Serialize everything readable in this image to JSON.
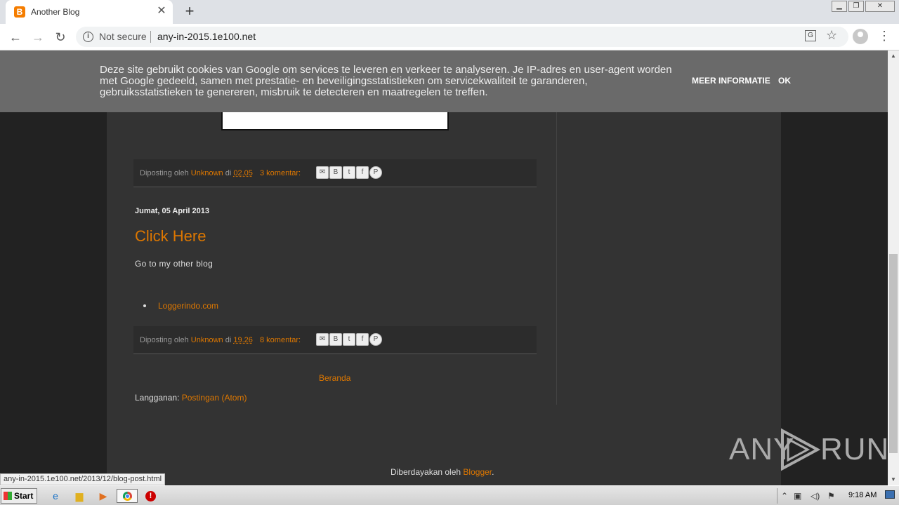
{
  "browser": {
    "tab_title": "Another Blog",
    "favicon_letter": "B",
    "tab_close": "✕",
    "new_tab": "+",
    "security_label": "Not secure",
    "url": "any-in-2015.1e100.net",
    "status_url": "any-in-2015.1e100.net/2013/12/blog-post.html"
  },
  "cookie_notice": {
    "text": "Deze site gebruikt cookies van Google om services te leveren en verkeer te analyseren. Je IP-adres en user-agent worden met Google gedeeld, samen met prestatie- en beveiligingsstatistieken om servicekwaliteit te garanderen, gebruiksstatistieken te genereren, misbruik te detecteren en maatregelen te treffen.",
    "more_info": "MEER INFORMATIE",
    "ok": "OK"
  },
  "posts": [
    {
      "footer": {
        "posted_by": "Diposting oleh",
        "author": "Unknown",
        "at": "di",
        "time": "02.05",
        "comments": "3 komentar:"
      }
    },
    {
      "date": "Jumat, 05 April 2013",
      "title": "Click Here",
      "body": "Go to my other blog",
      "links": [
        "Loggerindo.com"
      ],
      "footer": {
        "posted_by": "Diposting oleh",
        "author": "Unknown",
        "at": "di",
        "time": "19.26",
        "comments": "8 komentar:"
      }
    }
  ],
  "blog_nav": {
    "home": "Beranda",
    "subscribe_label": "Langganan:",
    "subscribe_link": "Postingan (Atom)",
    "powered_by": "Diberdayakan oleh",
    "powered_link": "Blogger",
    "powered_suffix": "."
  },
  "watermark": {
    "left": "ANY",
    "right": "RUN"
  },
  "taskbar": {
    "start": "Start",
    "clock": "9:18 AM"
  },
  "colors": {
    "accent": "#dd7700",
    "page_bg": "#222222",
    "content_bg": "#333333",
    "cookie_bg": "#6a6a6a"
  }
}
